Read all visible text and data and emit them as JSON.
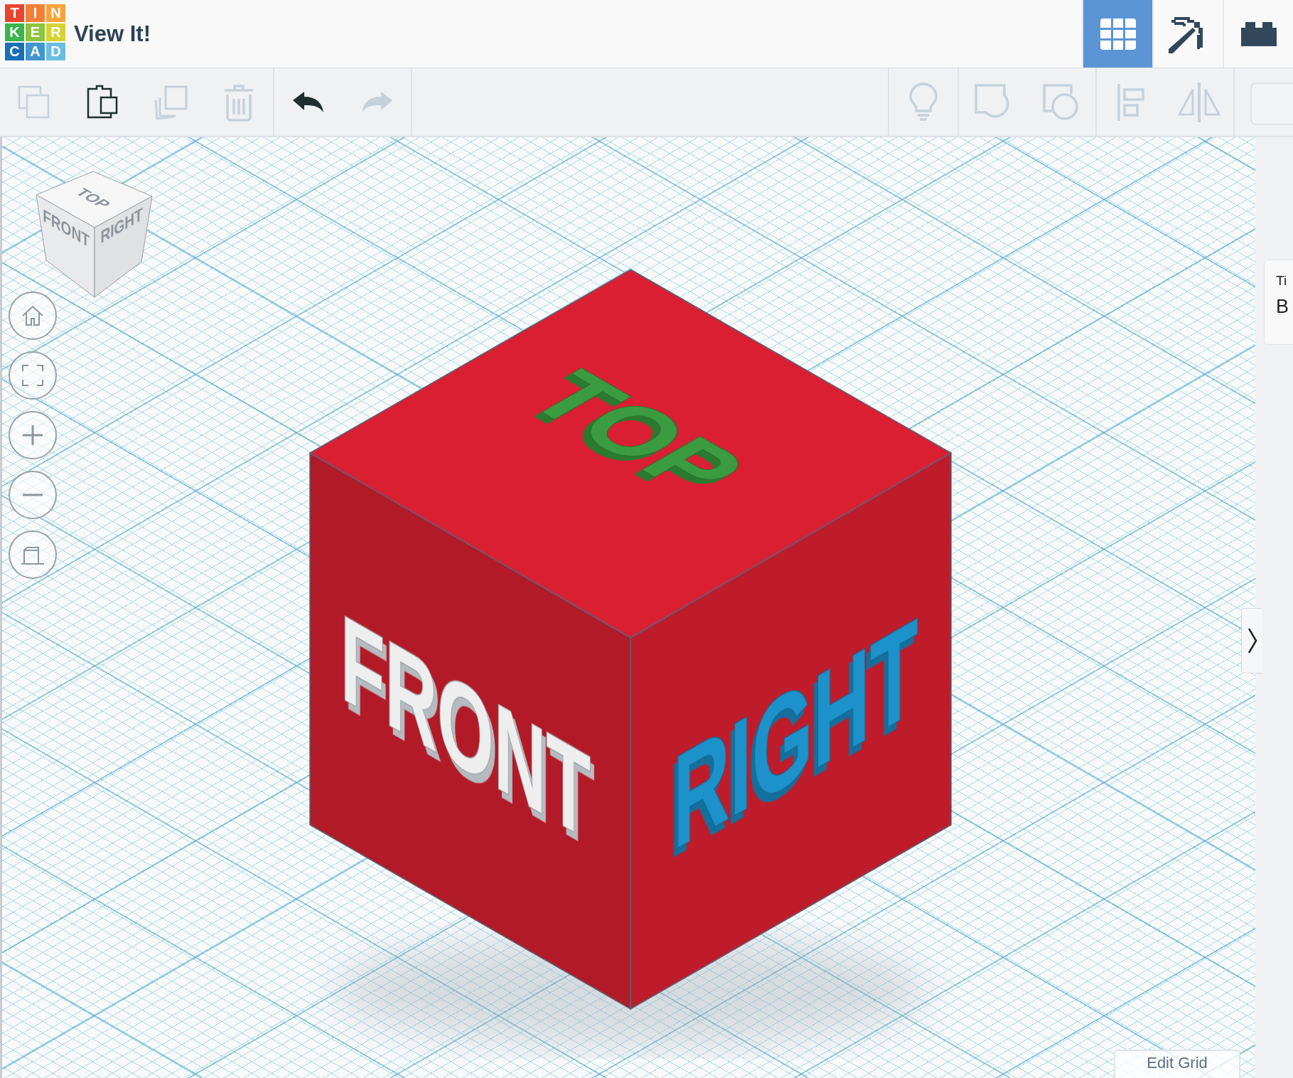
{
  "header": {
    "logo_letters": [
      "T",
      "I",
      "N",
      "K",
      "E",
      "R",
      "C",
      "A",
      "D"
    ],
    "title": "View It!"
  },
  "mode_buttons": [
    {
      "kind": "grid",
      "selected": true
    },
    {
      "kind": "pickaxe",
      "selected": false
    },
    {
      "kind": "bricks",
      "selected": false
    }
  ],
  "toolbar": {
    "left_groups": [
      [
        {
          "kind": "copy",
          "disabled": true
        },
        {
          "kind": "paste",
          "disabled": false
        },
        {
          "kind": "duplicate",
          "disabled": true
        },
        {
          "kind": "delete",
          "disabled": true
        }
      ],
      [
        {
          "kind": "undo",
          "disabled": false
        },
        {
          "kind": "redo",
          "disabled": true
        }
      ]
    ],
    "right_groups": [
      [
        {
          "kind": "note",
          "disabled": true
        }
      ],
      [
        {
          "kind": "group",
          "disabled": true
        },
        {
          "kind": "ungroup",
          "disabled": true
        }
      ],
      [
        {
          "kind": "align",
          "disabled": true
        },
        {
          "kind": "mirror",
          "disabled": true
        }
      ],
      [
        {
          "kind": "cut_off"
        }
      ]
    ]
  },
  "view_cube": {
    "top": "TOP",
    "front": "FRONT",
    "right": "RIGHT"
  },
  "nav_buttons": [
    {
      "kind": "home"
    },
    {
      "kind": "fit"
    },
    {
      "kind": "zoom_in"
    },
    {
      "kind": "zoom_out"
    },
    {
      "kind": "perspective"
    }
  ],
  "model": {
    "top_text": "TOP",
    "front_text": "FRONT",
    "right_text": "RIGHT"
  },
  "side_panel": {
    "card_lines": [
      "Ti",
      "B"
    ]
  },
  "edit_grid": "Edit Grid"
}
